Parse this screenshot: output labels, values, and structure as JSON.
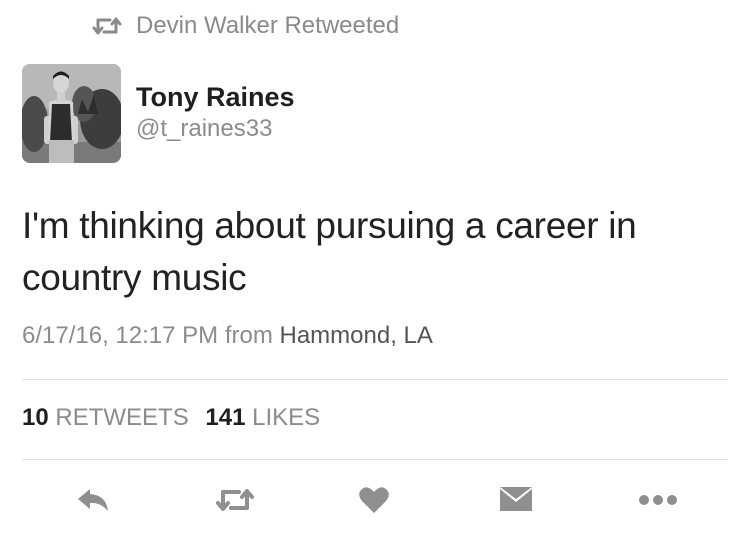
{
  "retweet_context": {
    "icon": "retweet-icon",
    "text": "Devin Walker Retweeted"
  },
  "tweet": {
    "author": {
      "display_name": "Tony Raines",
      "handle": "@t_raines33",
      "avatar": "avatar-photo"
    },
    "text_line1": "I'm thinking about pursuing a career in",
    "text_line2": "country music",
    "timestamp": "6/17/16, 12:17 PM",
    "from_label": "from",
    "location": "Hammond, LA"
  },
  "stats": {
    "retweets_count": "10",
    "retweets_label": "RETWEETS",
    "likes_count": "141",
    "likes_label": "LIKES"
  },
  "actions": [
    {
      "name": "reply",
      "icon": "reply-icon"
    },
    {
      "name": "retweet",
      "icon": "retweet-icon"
    },
    {
      "name": "like",
      "icon": "heart-icon"
    },
    {
      "name": "message",
      "icon": "envelope-icon"
    },
    {
      "name": "more",
      "icon": "more-dots-icon"
    }
  ],
  "colors": {
    "text_primary": "#1f1f1f",
    "text_secondary": "#8c8c8c",
    "icon": "#8f8f8f",
    "divider": "#e2e2e2"
  }
}
